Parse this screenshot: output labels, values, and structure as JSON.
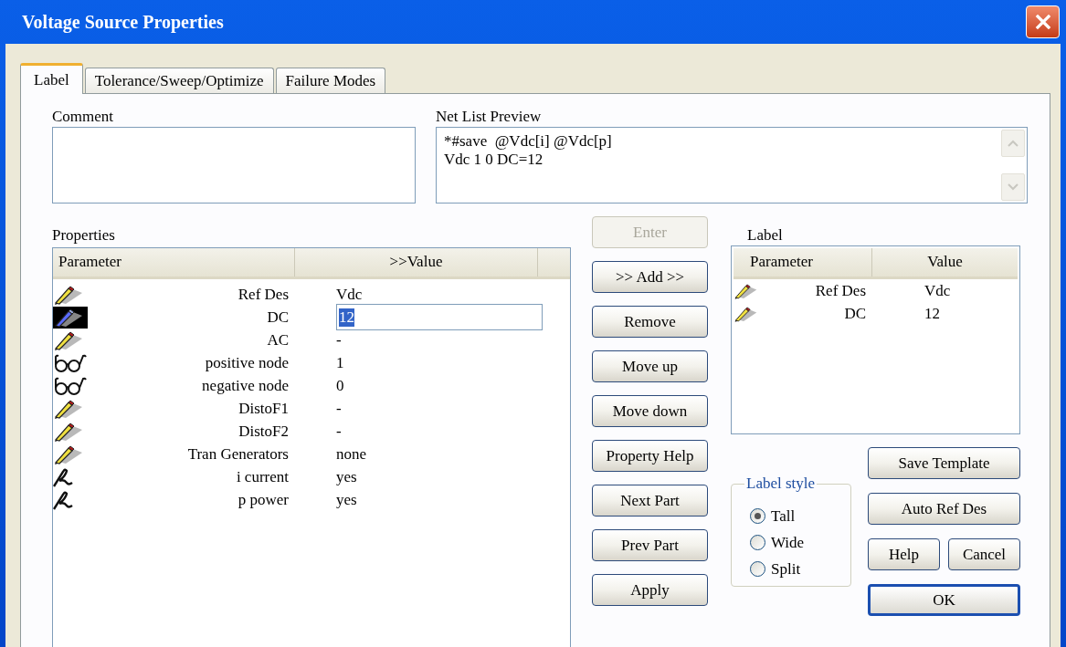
{
  "window": {
    "title": "Voltage Source Properties"
  },
  "tabs": [
    {
      "label": "Label",
      "selected": true
    },
    {
      "label": "Tolerance/Sweep/Optimize",
      "selected": false
    },
    {
      "label": "Failure Modes",
      "selected": false
    }
  ],
  "comment": {
    "label": "Comment"
  },
  "net_list_preview": {
    "label": "Net List Preview",
    "lines": [
      "*#save  @Vdc[i] @Vdc[p]",
      "Vdc 1 0 DC=12"
    ]
  },
  "properties": {
    "label": "Properties",
    "columns": [
      "Parameter",
      ">>Value"
    ],
    "rows": [
      {
        "kind": "pencil",
        "parameter": "Ref Des",
        "value": "Vdc",
        "selected": false
      },
      {
        "kind": "pencil",
        "parameter": "DC",
        "value": "12",
        "selected": true
      },
      {
        "kind": "pencil",
        "parameter": "AC",
        "value": "-",
        "selected": false
      },
      {
        "kind": "glasses",
        "parameter": "positive node",
        "value": "1",
        "selected": false
      },
      {
        "kind": "glasses",
        "parameter": "negative node",
        "value": "0",
        "selected": false
      },
      {
        "kind": "pencil",
        "parameter": "DistoF1",
        "value": "-",
        "selected": false
      },
      {
        "kind": "pencil",
        "parameter": "DistoF2",
        "value": "-",
        "selected": false
      },
      {
        "kind": "pencil",
        "parameter": "Tran Generators",
        "value": "none",
        "selected": false
      },
      {
        "kind": "pen",
        "parameter": "i current",
        "value": "yes",
        "selected": false
      },
      {
        "kind": "pen",
        "parameter": "p power",
        "value": "yes",
        "selected": false
      }
    ]
  },
  "action_buttons": [
    {
      "label": "Enter",
      "disabled": true
    },
    {
      "label": ">> Add >>",
      "disabled": false
    },
    {
      "label": "Remove",
      "disabled": false
    },
    {
      "label": "Move up",
      "disabled": false
    },
    {
      "label": "Move down",
      "disabled": false
    },
    {
      "label": "Property Help",
      "disabled": false
    },
    {
      "label": "Next Part",
      "disabled": false
    },
    {
      "label": "Prev Part",
      "disabled": false
    },
    {
      "label": "Apply",
      "disabled": false
    }
  ],
  "label_list": {
    "label": "Label",
    "columns": [
      "Parameter",
      "Value"
    ],
    "rows": [
      {
        "kind": "pencil",
        "parameter": "Ref Des",
        "value": "Vdc"
      },
      {
        "kind": "pencil",
        "parameter": "DC",
        "value": "12"
      }
    ]
  },
  "label_style": {
    "title": "Label style",
    "options": [
      {
        "label": "Tall",
        "selected": true
      },
      {
        "label": "Wide",
        "selected": false
      },
      {
        "label": "Split",
        "selected": false
      }
    ]
  },
  "dialog_button_rows": [
    {
      "buttons": [
        {
          "label": "Save Template",
          "default": false
        }
      ]
    },
    {
      "buttons": [
        {
          "label": "Auto Ref Des",
          "default": false
        }
      ]
    },
    {
      "buttons": [
        {
          "label": "Help",
          "default": false
        },
        {
          "label": "Cancel",
          "default": false
        }
      ]
    },
    {
      "buttons": [
        {
          "label": "OK",
          "default": true
        }
      ]
    }
  ]
}
